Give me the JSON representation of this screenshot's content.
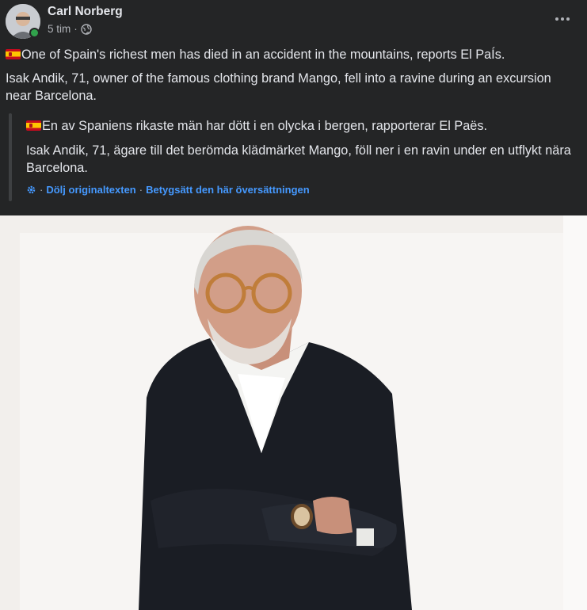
{
  "post": {
    "author": "Carl Norberg",
    "time": "5 tim",
    "separator": "·",
    "english_line1": "One of Spain's richest men has died in an accident in the mountains, reports El PaÍs.",
    "english_line2": "Isak Andik, 71, owner of the famous clothing brand Mango, fell into a ravine during an excursion near Barcelona.",
    "swedish_line1": "En av Spaniens rikaste män har dött i en olycka i bergen, rapporterar El Paës.",
    "swedish_line2": "Isak Andik, 71, ägare till det berömda klädmärket Mango, föll ner i en ravin under en utflykt nära Barcelona.",
    "hide_original": "Dölj originaltexten",
    "rate_translation": "Betygsätt den här översättningen",
    "dot": "·"
  },
  "icons": {
    "more": "more-horizontal-icon",
    "privacy": "globe-icon",
    "translate": "gear-icon",
    "flag": "spain-flag-icon"
  },
  "colors": {
    "background": "#242526",
    "text": "#e4e6eb",
    "secondary": "#b0b3b8",
    "link": "#4599ff",
    "online": "#31a24c"
  }
}
